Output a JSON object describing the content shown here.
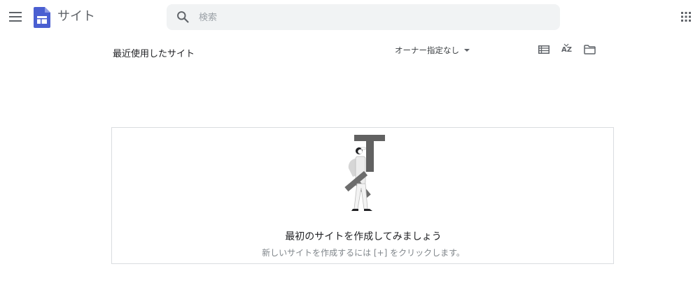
{
  "header": {
    "app_title": "サイト",
    "search": {
      "placeholder": "検索",
      "value": ""
    }
  },
  "toolbar": {
    "section_title": "最近使用したサイト",
    "owner_filter_label": "オーナー指定なし",
    "sort_label": "AZ"
  },
  "empty_state": {
    "heading": "最初のサイトを作成してみましょう",
    "subtext": "新しいサイトを作成するには [+] をクリックします。"
  },
  "colors": {
    "brand": "#4a5fd1",
    "icon_gray": "#5f6368",
    "search_bg": "#f1f3f4",
    "border": "#dadce0"
  },
  "icons": [
    "menu-icon",
    "sites-logo-icon",
    "search-icon",
    "apps-grid-icon",
    "dropdown-caret-icon",
    "list-view-icon",
    "sort-az-icon",
    "folder-icon"
  ]
}
